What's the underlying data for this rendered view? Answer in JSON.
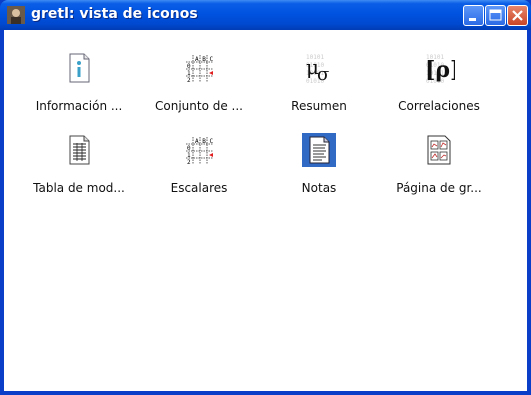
{
  "window": {
    "title": "gretl: vista de iconos"
  },
  "icons": [
    {
      "label": "Información ...",
      "icon": "info-document-icon"
    },
    {
      "label": "Conjunto de ...",
      "icon": "dataset-grid-icon"
    },
    {
      "label": "Resumen",
      "icon": "summary-mu-sigma-icon"
    },
    {
      "label": "Correlaciones",
      "icon": "correlation-rho-icon"
    },
    {
      "label": "Tabla de mod...",
      "icon": "model-table-icon"
    },
    {
      "label": "Escalares",
      "icon": "scalars-grid-icon"
    },
    {
      "label": "Notas",
      "icon": "notes-document-icon",
      "selected": true
    },
    {
      "label": "Página de gr...",
      "icon": "graph-page-icon"
    }
  ],
  "colors": {
    "titlebar": "#0053e0",
    "selection": "#316ac5",
    "close_button": "#c94527"
  }
}
